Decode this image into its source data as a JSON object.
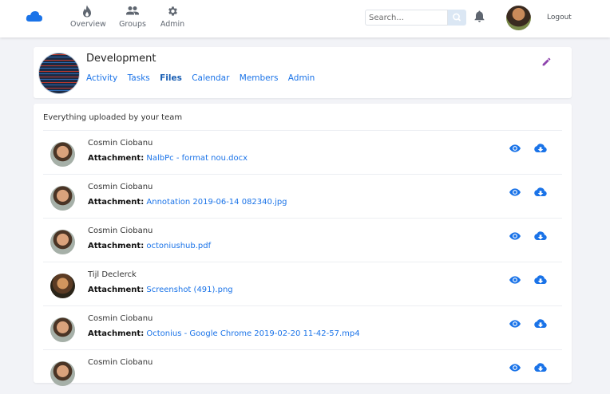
{
  "nav": {
    "items": [
      {
        "label": "Overview",
        "icon": "flame-icon"
      },
      {
        "label": "Groups",
        "icon": "people-icon"
      },
      {
        "label": "Admin",
        "icon": "gear-icon"
      }
    ],
    "search_placeholder": "Search...",
    "logout_label": "Logout"
  },
  "group": {
    "title": "Development",
    "tabs": [
      "Activity",
      "Tasks",
      "Files",
      "Calendar",
      "Members",
      "Admin"
    ],
    "active_tab": "Files"
  },
  "files": {
    "heading": "Everything uploaded by your team",
    "attachment_label": "Attachment:",
    "rows": [
      {
        "user": "Cosmin Ciobanu",
        "file": "NalbPc - format nou.docx"
      },
      {
        "user": "Cosmin Ciobanu",
        "file": "Annotation 2019-06-14 082340.jpg"
      },
      {
        "user": "Cosmin Ciobanu",
        "file": "octoniushub.pdf"
      },
      {
        "user": "Tijl Declerck",
        "file": "Screenshot (491).png"
      },
      {
        "user": "Cosmin Ciobanu",
        "file": "Octonius - Google Chrome 2019-02-20 11-42-57.mp4"
      },
      {
        "user": "Cosmin Ciobanu",
        "file": ""
      }
    ]
  },
  "colors": {
    "accent": "#1a73e8",
    "edit_icon": "#8e44ad",
    "background": "#f2f3f7"
  }
}
